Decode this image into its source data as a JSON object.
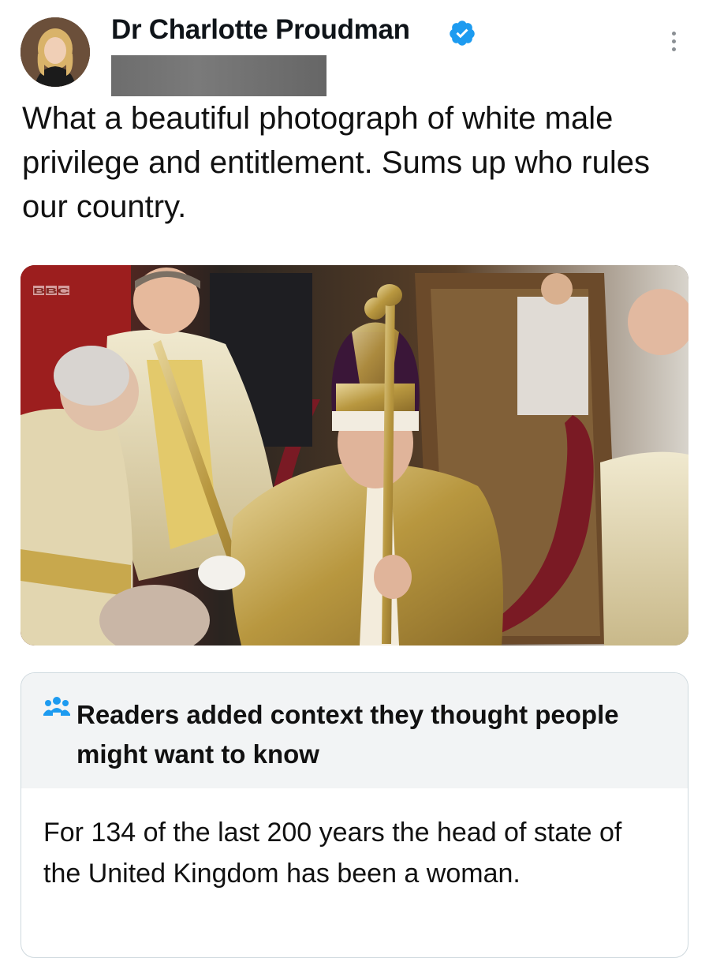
{
  "author": {
    "name": "Dr Charlotte Proudman",
    "avatar_icon": "profile-photo",
    "verified_icon": "verified-badge-icon",
    "verified_color": "#1d9bf0"
  },
  "tweet": {
    "text": "What a beautiful photograph of white male privilege and entitlement. Sums up who rules our country."
  },
  "media": {
    "watermark": "BBC"
  },
  "community_note": {
    "icon": "people-icon",
    "heading": "Readers added context they thought people might want to know",
    "body": "For 134 of the last 200 years the head of state of the United Kingdom has been a woman."
  },
  "more_icon": "more-options-icon"
}
